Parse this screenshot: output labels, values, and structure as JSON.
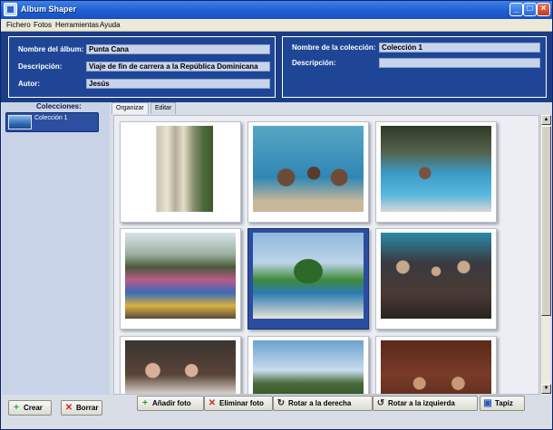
{
  "window": {
    "title": "Album Shaper"
  },
  "menu": [
    "Fichero",
    "Fotos",
    "Herramientas",
    "Ayuda"
  ],
  "album": {
    "name_label": "Nombre del álbum:",
    "name_value": "Punta Cana",
    "desc_label": "Descripción:",
    "desc_value": "Viaje de fin de carrera a la República Dominicana",
    "author_label": "Autor:",
    "author_value": "Jesús"
  },
  "collection": {
    "name_label": "Nombre de la colección:",
    "name_value": "Colección 1",
    "desc_label": "Descripción:",
    "desc_value": ""
  },
  "sidebar": {
    "title": "Colecciones:",
    "items": [
      {
        "label": "Colección 1"
      }
    ],
    "create_label": "Crear",
    "delete_label": "Borrar"
  },
  "tabs": [
    "Organizar",
    "Editar"
  ],
  "toolbar": {
    "add_label": "Añadir foto",
    "remove_label": "Eliminar foto",
    "rotate_right_label": "Rotar a la derecha",
    "rotate_left_label": "Rotar a la izquierda",
    "wallpaper_label": "Tapiz"
  },
  "icons": {
    "app": "album-icon",
    "add": "plus-icon",
    "remove": "x-icon",
    "rotate_right": "rotate-right-icon",
    "rotate_left": "rotate-left-icon",
    "wallpaper": "monitor-icon"
  },
  "colors": {
    "title_bar": "#1f5ecf",
    "info_panel": "#1f4696",
    "selected_frame": "#2b4da0",
    "add_icon": "#2e9a2e",
    "remove_icon": "#d02a1a"
  }
}
